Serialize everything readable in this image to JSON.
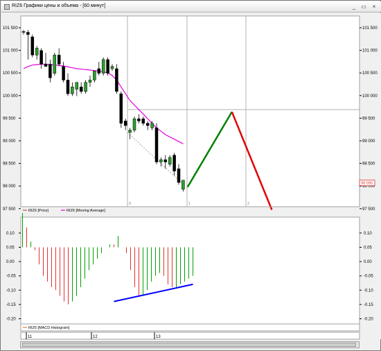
{
  "window": {
    "title": "RIZ6 Графики цены и объема - [60 минут]",
    "controls": [
      "_",
      "▭",
      "×"
    ]
  },
  "price_pane": {
    "y_ticks": [
      "101 500",
      "101 000",
      "100 500",
      "100 000",
      "99 500",
      "99 000",
      "98 500",
      "98 000",
      "97 500"
    ],
    "current_price_label": "98 090",
    "cursor_labels": [
      "0",
      "1",
      "2"
    ],
    "legend": [
      {
        "label": "RIZ6 [Price]",
        "color": "#c0504d"
      },
      {
        "label": "RIZ6 [Moving Average]",
        "color": "#e000e0"
      }
    ]
  },
  "macd_pane": {
    "y_ticks": [
      "0.10",
      "0.05",
      "0.00",
      "-0.05",
      "-0.10",
      "-0.15",
      "-0.20"
    ],
    "legend": [
      {
        "label": "RIZ6 [MACD Histogram]",
        "color": "#e07a2b"
      }
    ]
  },
  "time_axis": {
    "labels": [
      "11",
      "12",
      "13"
    ]
  },
  "chart_data": [
    {
      "type": "candlestick",
      "title": "RIZ6 [Price]",
      "ylim": [
        97500,
        101750
      ],
      "candles": [
        {
          "o": 101400,
          "h": 101450,
          "l": 101350,
          "c": 101420
        },
        {
          "o": 101400,
          "h": 101450,
          "l": 100800,
          "c": 101350
        },
        {
          "o": 101300,
          "h": 101350,
          "l": 100850,
          "c": 100900
        },
        {
          "o": 100900,
          "h": 101100,
          "l": 100800,
          "c": 101050
        },
        {
          "o": 101000,
          "h": 101050,
          "l": 100600,
          "c": 100700
        },
        {
          "o": 100700,
          "h": 100950,
          "l": 100650,
          "c": 100650
        },
        {
          "o": 100700,
          "h": 100800,
          "l": 100300,
          "c": 100400
        },
        {
          "o": 100500,
          "h": 100950,
          "l": 100450,
          "c": 100900
        },
        {
          "o": 100900,
          "h": 101050,
          "l": 100650,
          "c": 100700
        },
        {
          "o": 100650,
          "h": 100750,
          "l": 100300,
          "c": 100350
        },
        {
          "o": 100350,
          "h": 100500,
          "l": 100000,
          "c": 100050
        },
        {
          "o": 100050,
          "h": 100300,
          "l": 100000,
          "c": 100200
        },
        {
          "o": 100150,
          "h": 100300,
          "l": 100000,
          "c": 100300
        },
        {
          "o": 100200,
          "h": 100300,
          "l": 100050,
          "c": 100100
        },
        {
          "o": 100100,
          "h": 100350,
          "l": 100050,
          "c": 100300
        },
        {
          "o": 100300,
          "h": 100450,
          "l": 100200,
          "c": 100350
        },
        {
          "o": 100350,
          "h": 100550,
          "l": 100300,
          "c": 100550
        },
        {
          "o": 100600,
          "h": 100750,
          "l": 100450,
          "c": 100500
        },
        {
          "o": 100500,
          "h": 100850,
          "l": 100450,
          "c": 100800
        },
        {
          "o": 100800,
          "h": 100850,
          "l": 100450,
          "c": 100500
        },
        {
          "o": 100600,
          "h": 100700,
          "l": 100550,
          "c": 100650
        },
        {
          "o": 100600,
          "h": 100700,
          "l": 100050,
          "c": 100100
        },
        {
          "o": 100050,
          "h": 100100,
          "l": 99300,
          "c": 99400
        },
        {
          "o": 99450,
          "h": 99500,
          "l": 99250,
          "c": 99350
        },
        {
          "o": 99200,
          "h": 99300,
          "l": 99050,
          "c": 99250
        },
        {
          "o": 99250,
          "h": 99550,
          "l": 99200,
          "c": 99500
        },
        {
          "o": 99500,
          "h": 99600,
          "l": 99400,
          "c": 99450
        },
        {
          "o": 99500,
          "h": 99550,
          "l": 99350,
          "c": 99400
        },
        {
          "o": 99400,
          "h": 99450,
          "l": 99250,
          "c": 99350
        },
        {
          "o": 99300,
          "h": 99450,
          "l": 99250,
          "c": 99400
        },
        {
          "o": 99300,
          "h": 99400,
          "l": 98500,
          "c": 98550
        },
        {
          "o": 98550,
          "h": 98650,
          "l": 98450,
          "c": 98600
        },
        {
          "o": 98600,
          "h": 98700,
          "l": 98400,
          "c": 98550
        },
        {
          "o": 98500,
          "h": 98700,
          "l": 98450,
          "c": 98650
        },
        {
          "o": 98700,
          "h": 98750,
          "l": 98250,
          "c": 98350
        },
        {
          "o": 98400,
          "h": 98500,
          "l": 98050,
          "c": 98100
        },
        {
          "o": 97950,
          "h": 98150,
          "l": 97900,
          "c": 98150
        }
      ],
      "moving_average": [
        100600,
        100650,
        100680,
        100690,
        100700,
        100700,
        100690,
        100680,
        100670,
        100660,
        100640,
        100620,
        100600,
        100590,
        100580,
        100570,
        100560,
        100550,
        100530,
        100510,
        100450,
        100350,
        100200,
        100050,
        99900,
        99800,
        99700,
        99600,
        99500,
        99400,
        99300
      ]
    },
    {
      "type": "line",
      "title": "Forecast projection",
      "series": [
        {
          "color": "#008000",
          "points": [
            [
              37,
              98000
            ],
            [
              47,
              99650
            ]
          ]
        },
        {
          "color": "#e00000",
          "points": [
            [
              47,
              99650
            ],
            [
              56,
              97500
            ]
          ]
        }
      ]
    },
    {
      "type": "bar",
      "title": "RIZ6 [MACD Histogram]",
      "ylim": [
        -0.21,
        0.13
      ],
      "values": [
        0.12,
        0.07,
        0.02,
        -0.01,
        -0.06,
        -0.1,
        -0.12,
        -0.14,
        -0.15,
        -0.17,
        -0.19,
        -0.2,
        -0.19,
        -0.17,
        -0.14,
        -0.11,
        -0.08,
        -0.06,
        -0.04,
        -0.02,
        0.0,
        0.01,
        0.01,
        0.04,
        0.0,
        -0.02,
        -0.08,
        -0.14,
        -0.17,
        -0.17,
        -0.15,
        -0.12,
        -0.1,
        -0.09,
        -0.1,
        -0.13,
        -0.14,
        -0.14,
        -0.13,
        -0.12,
        -0.11,
        -0.1
      ],
      "colors": [
        "#00a000",
        "#e03030",
        "#00a000",
        "#e03030",
        "#e03030",
        "#e03030",
        "#e03030",
        "#e03030",
        "#e03030",
        "#e03030",
        "#e03030",
        "#e03030",
        "#00a000",
        "#00a000",
        "#00a000",
        "#00a000",
        "#00a000",
        "#00a000",
        "#00a000",
        "#00a000",
        "#e03030",
        "#00a000",
        "#e03030",
        "#00a000",
        "#e03030",
        "#e03030",
        "#e03030",
        "#e03030",
        "#e03030",
        "#00a000",
        "#00a000",
        "#00a000",
        "#00a000",
        "#00a000",
        "#e03030",
        "#e03030",
        "#e03030",
        "#00a000",
        "#00a000",
        "#00a000",
        "#00a000",
        "#00a000"
      ],
      "trendline": {
        "color": "#0000ff",
        "points": [
          [
            22,
            -0.19
          ],
          [
            41,
            -0.13
          ]
        ]
      }
    }
  ]
}
